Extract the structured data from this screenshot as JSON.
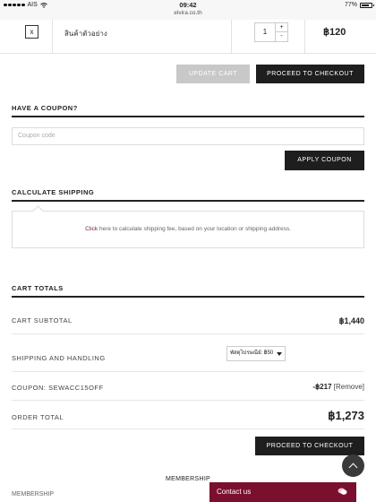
{
  "status_bar": {
    "carrier": "AIS",
    "time": "09:42",
    "url": "elvira.co.th",
    "battery": "77%",
    "battery_level": 0.77
  },
  "cart_row": {
    "remove_label": "x",
    "product_name": "สินค้าตัวอย่าง",
    "quantity": "1",
    "plus": "+",
    "minus": "-",
    "price": "฿120"
  },
  "cart_actions": {
    "update_label": "UPDATE CART",
    "checkout_label": "PROCEED TO CHECKOUT"
  },
  "coupon": {
    "title": "HAVE A COUPON?",
    "placeholder": "Coupon code",
    "apply_label": "APPLY COUPON"
  },
  "shipping_calc": {
    "title": "CALCULATE SHIPPING",
    "click": "Click",
    "text": " here to calculate shipping fee, based on your location or shipping address."
  },
  "totals": {
    "title": "CART TOTALS",
    "subtotal_label": "CART SUBTOTAL",
    "subtotal_value": "฿1,440",
    "shipping_label": "SHIPPING AND HANDLING",
    "shipping_option": "พัสดุไปรษณีย์: ฿50",
    "coupon_label": "COUPON: SEWACC15OFF",
    "coupon_amount": "-฿217",
    "coupon_remove": "[Remove]",
    "order_label": "ORDER TOTAL",
    "order_value": "฿1,273",
    "checkout_label": "PROCEED TO CHECKOUT"
  },
  "footer": {
    "membership_heading": "MEMBERSHIP",
    "membership_link": "MEMBERSHIP",
    "contact_label": "Contact us"
  },
  "colors": {
    "brand": "#7a0f2e",
    "dark_button": "#1e1e1e",
    "disabled_button": "#c8c8c8"
  },
  "icons": [
    "wifi-icon",
    "battery-icon",
    "close-icon",
    "chevron-up-icon",
    "chat-icon",
    "dropdown-caret-icon"
  ]
}
